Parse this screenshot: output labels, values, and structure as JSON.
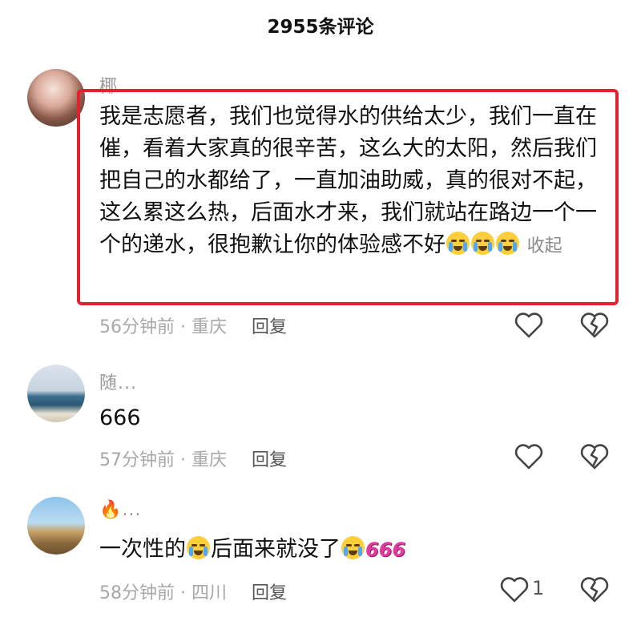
{
  "header": {
    "title": "2955条评论"
  },
  "comments": [
    {
      "username": "椰...",
      "text": "我是志愿者，我们也觉得水的供给太少，我们一直在催，看着大家真的很辛苦，这么大的太阳，然后我们把自己的水都给了，一直加油助威，真的很对不起，这么累这么热，后面水才来，我们就站在路边一个一个的递水，很抱歉让你的体验感不好",
      "emoji_names": [
        "loudly-crying-face",
        "loudly-crying-face",
        "loudly-crying-face"
      ],
      "collapse_label": "收起",
      "time": "56分钟前",
      "location": "重庆",
      "reply_label": "回复",
      "highlighted": true
    },
    {
      "username": "随...",
      "text": "666",
      "time": "57分钟前",
      "location": "重庆",
      "reply_label": "回复"
    },
    {
      "username": "...",
      "username_icon": "fire-icon",
      "text_before": "一次性的",
      "text_middle": "后面来就没了",
      "emoji_names": [
        "rolling-on-floor-laughing",
        "rolling-on-floor-laughing"
      ],
      "sticker_text": "666",
      "time": "58分钟前",
      "location": "四川",
      "reply_label": "回复",
      "like_count": "1"
    }
  ],
  "colors": {
    "highlight_border": "#e0242f",
    "sticker": "#e23ba0"
  }
}
